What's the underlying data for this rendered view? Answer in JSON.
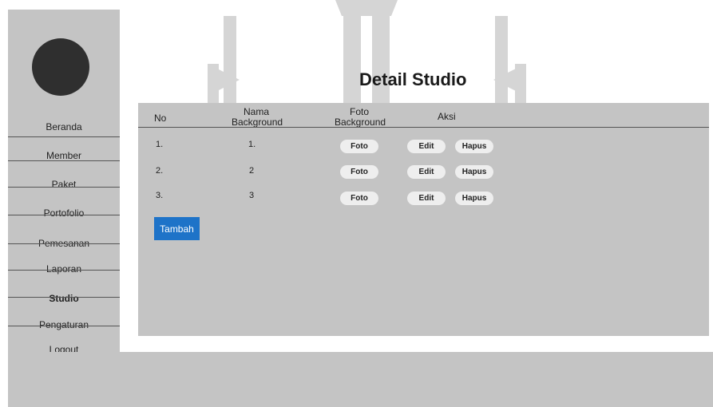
{
  "page_title": "Detail Studio",
  "sidebar": {
    "items": [
      {
        "label": "Beranda"
      },
      {
        "label": "Member"
      },
      {
        "label": "Paket"
      },
      {
        "label": "Portofolio"
      },
      {
        "label": "Pemesanan"
      },
      {
        "label": "Laporan"
      },
      {
        "label": "Studio"
      },
      {
        "label": "Pengaturan"
      },
      {
        "label": "Logout"
      }
    ]
  },
  "table": {
    "headers": {
      "no": "No",
      "nama_line1": "Nama",
      "nama_line2": "Background",
      "foto_line1": "Foto",
      "foto_line2": "Background",
      "aksi": "Aksi"
    },
    "rows": [
      {
        "no": "1.",
        "nama": "1.",
        "foto": "Foto",
        "edit": "Edit",
        "hapus": "Hapus"
      },
      {
        "no": "2.",
        "nama": "2",
        "foto": "Foto",
        "edit": "Edit",
        "hapus": "Hapus"
      },
      {
        "no": "3.",
        "nama": "3",
        "foto": "Foto",
        "edit": "Edit",
        "hapus": "Hapus"
      }
    ]
  },
  "add_button_label": "Tambah",
  "colors": {
    "accent": "#1e73c8",
    "panel": "#c4c4c4",
    "avatar": "#2f2f2f"
  }
}
